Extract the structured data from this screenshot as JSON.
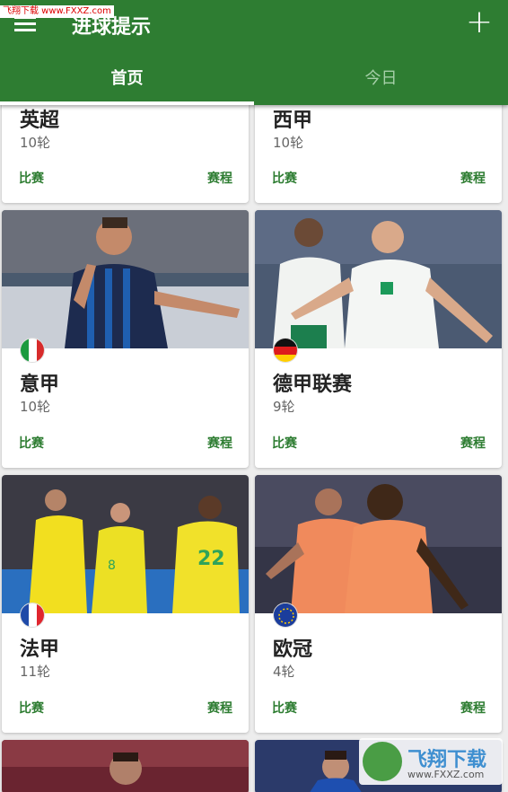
{
  "watermark_top": "飞翔下载 www.FXXZ.com",
  "header": {
    "title": "进球提示",
    "add_icon": "plus-icon",
    "menu_icon": "hamburger-menu-icon",
    "background_color": "#2e7d32"
  },
  "tabs": [
    {
      "label": "首页",
      "active": true
    },
    {
      "label": "今日",
      "active": false
    }
  ],
  "cards": [
    {
      "name": "英超",
      "rounds": "10轮",
      "action_left": "比赛",
      "action_right": "赛程"
    },
    {
      "name": "西甲",
      "rounds": "10轮",
      "action_left": "比赛",
      "action_right": "赛程"
    },
    {
      "name": "意甲",
      "rounds": "10轮",
      "flag": "italy-flag-icon",
      "action_left": "比赛",
      "action_right": "赛程"
    },
    {
      "name": "德甲联赛",
      "rounds": "9轮",
      "flag": "germany-flag-icon",
      "action_left": "比赛",
      "action_right": "赛程"
    },
    {
      "name": "法甲",
      "rounds": "11轮",
      "flag": "france-flag-icon",
      "action_left": "比赛",
      "action_right": "赛程"
    },
    {
      "name": "欧冠",
      "rounds": "4轮",
      "flag": "eu-flag-icon",
      "action_left": "比赛",
      "action_right": "赛程"
    }
  ],
  "watermark_bottom": {
    "text": "飞翔下载",
    "url": "www.FXXZ.com"
  }
}
